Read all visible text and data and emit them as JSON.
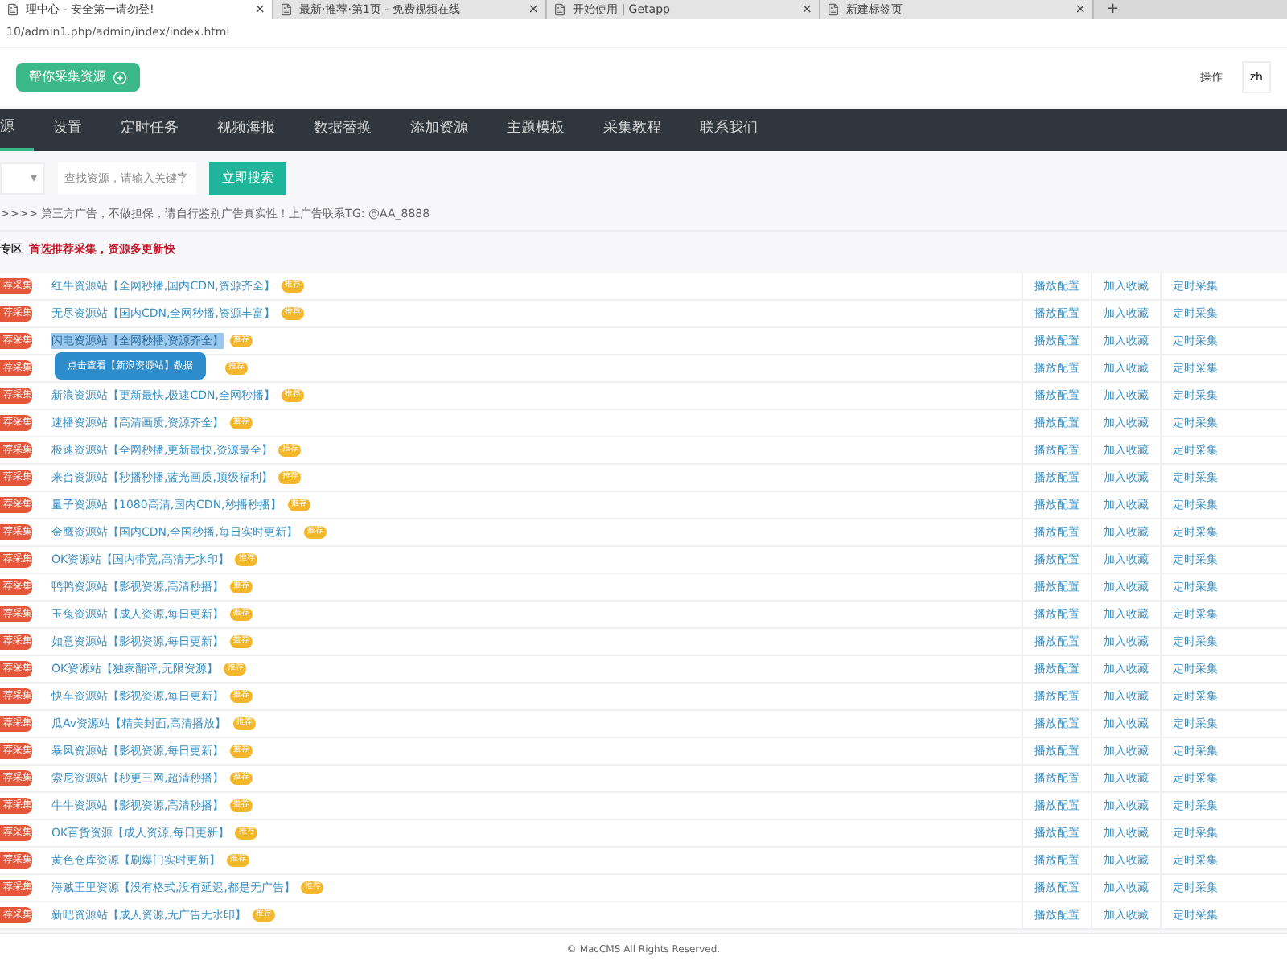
{
  "browser": {
    "tabs": [
      {
        "title": "理中心 - 安全第一请勿登!",
        "selected": true
      },
      {
        "title": "最新·推荐·第1页 - 免费视频在线",
        "selected": false
      },
      {
        "title": "开始使用 | Getapp",
        "selected": false
      },
      {
        "title": "新建标签页",
        "selected": false
      }
    ],
    "close": "×",
    "new_tab": "+",
    "url": "10/admin1.php/admin/index/index.html"
  },
  "header": {
    "button": "帮你采集资源",
    "action_label": "操作",
    "language": "zh"
  },
  "nav": [
    {
      "label": "源",
      "selected": true
    },
    {
      "label": "设置",
      "selected": false
    },
    {
      "label": "定时任务",
      "selected": false
    },
    {
      "label": "视频海报",
      "selected": false
    },
    {
      "label": "数据替换",
      "selected": false
    },
    {
      "label": "添加资源",
      "selected": false
    },
    {
      "label": "主题模板",
      "selected": false
    },
    {
      "label": "采集教程",
      "selected": false
    },
    {
      "label": "联系我们",
      "selected": false
    }
  ],
  "search": {
    "select_caret": "▾",
    "placeholder": "查找资源，请输入关键字",
    "button": "立即搜索"
  },
  "notice": ">>>> 第三方广告，不做担保，请自行鉴别广告真实性！上广告联系TG: @AA_8888",
  "section": {
    "title": "专区",
    "subtitle": "首选推荐采集，资源多更新快"
  },
  "tooltip": {
    "text": "点击查看【新浪资源站】数据"
  },
  "rows": [
    {
      "badge": "荐采集",
      "name": "红牛资源站【全网秒播,国内CDN,资源齐全】",
      "tag": "推荐",
      "selected": false,
      "actions": [
        "播放配置",
        "加入收藏",
        "定时采集"
      ]
    },
    {
      "badge": "荐采集",
      "name": "无尽资源站【国内CDN,全网秒播,资源丰富】",
      "tag": "推荐",
      "selected": false,
      "actions": [
        "播放配置",
        "加入收藏",
        "定时采集"
      ]
    },
    {
      "badge": "荐采集",
      "name": "闪电资源站【全网秒播,资源齐全】",
      "tag": "推荐",
      "selected": true,
      "actions": [
        "播放配置",
        "加入收藏",
        "定时采集"
      ]
    },
    {
      "badge": "荐采集",
      "tag": "推荐",
      "selected": false,
      "actions": [
        "播放配置",
        "加入收藏",
        "定时采集"
      ]
    },
    {
      "badge": "荐采集",
      "name": "新浪资源站【更新最快,极速CDN,全网秒播】",
      "tag": "推荐",
      "selected": false,
      "actions": [
        "播放配置",
        "加入收藏",
        "定时采集"
      ]
    },
    {
      "badge": "荐采集",
      "name": "速播资源站【高清画质,资源齐全】",
      "tag": "推荐",
      "selected": false,
      "actions": [
        "播放配置",
        "加入收藏",
        "定时采集"
      ]
    },
    {
      "badge": "荐采集",
      "name": "极速资源站【全网秒播,更新最快,资源最全】",
      "tag": "推荐",
      "selected": false,
      "actions": [
        "播放配置",
        "加入收藏",
        "定时采集"
      ]
    },
    {
      "badge": "荐采集",
      "name": "来台资源站【秒播秒播,蓝光画质,顶级福利】",
      "tag": "推荐",
      "selected": false,
      "actions": [
        "播放配置",
        "加入收藏",
        "定时采集"
      ]
    },
    {
      "badge": "荐采集",
      "name": "量子资源站【1080高清,国内CDN,秒播秒播】",
      "tag": "推荐",
      "selected": false,
      "actions": [
        "播放配置",
        "加入收藏",
        "定时采集"
      ]
    },
    {
      "badge": "荐采集",
      "name": "金鹰资源站【国内CDN,全国秒播,每日实时更新】",
      "tag": "推荐",
      "selected": false,
      "actions": [
        "播放配置",
        "加入收藏",
        "定时采集"
      ]
    },
    {
      "badge": "荐采集",
      "name": "OK资源站【国内带宽,高清无水印】",
      "tag": "推荐",
      "selected": false,
      "actions": [
        "播放配置",
        "加入收藏",
        "定时采集"
      ]
    },
    {
      "badge": "荐采集",
      "name": "鸭鸭资源站【影视资源,高清秒播】",
      "tag": "推荐",
      "selected": false,
      "actions": [
        "播放配置",
        "加入收藏",
        "定时采集"
      ]
    },
    {
      "badge": "荐采集",
      "name": "玉兔资源站【成人资源,每日更新】",
      "tag": "推荐",
      "selected": false,
      "actions": [
        "播放配置",
        "加入收藏",
        "定时采集"
      ]
    },
    {
      "badge": "荐采集",
      "name": "如意资源站【影视资源,每日更新】",
      "tag": "推荐",
      "selected": false,
      "actions": [
        "播放配置",
        "加入收藏",
        "定时采集"
      ]
    },
    {
      "badge": "荐采集",
      "name": "OK资源站【独家翻译,无限资源】",
      "tag": "推荐",
      "selected": false,
      "actions": [
        "播放配置",
        "加入收藏",
        "定时采集"
      ]
    },
    {
      "badge": "荐采集",
      "name": "快车资源站【影视资源,每日更新】",
      "tag": "推荐",
      "selected": false,
      "actions": [
        "播放配置",
        "加入收藏",
        "定时采集"
      ]
    },
    {
      "badge": "荐采集",
      "name": "瓜Av资源站【精美封面,高清播放】",
      "tag": "推荐",
      "selected": false,
      "actions": [
        "播放配置",
        "加入收藏",
        "定时采集"
      ]
    },
    {
      "badge": "荐采集",
      "name": "暴风资源站【影视资源,每日更新】",
      "tag": "推荐",
      "selected": false,
      "actions": [
        "播放配置",
        "加入收藏",
        "定时采集"
      ]
    },
    {
      "badge": "荐采集",
      "name": "索尼资源站【秒更三网,超清秒播】",
      "tag": "推荐",
      "selected": false,
      "actions": [
        "播放配置",
        "加入收藏",
        "定时采集"
      ]
    },
    {
      "badge": "荐采集",
      "name": "牛牛资源站【影视资源,高清秒播】",
      "tag": "推荐",
      "selected": false,
      "actions": [
        "播放配置",
        "加入收藏",
        "定时采集"
      ]
    },
    {
      "badge": "荐采集",
      "name": "OK百货资源【成人资源,每日更新】",
      "tag": "推荐",
      "selected": false,
      "actions": [
        "播放配置",
        "加入收藏",
        "定时采集"
      ]
    },
    {
      "badge": "荐采集",
      "name": "黄色仓库资源【刷爆门实时更新】",
      "tag": "推荐",
      "selected": false,
      "actions": [
        "播放配置",
        "加入收藏",
        "定时采集"
      ]
    },
    {
      "badge": "荐采集",
      "name": "海贼王里资源【没有格式,没有延迟,都是无广告】",
      "tag": "推荐",
      "selected": false,
      "actions": [
        "播放配置",
        "加入收藏",
        "定时采集"
      ]
    },
    {
      "badge": "荐采集",
      "name": "新吧资源站【成人资源,无广告无水印】",
      "tag": "推荐",
      "selected": false,
      "actions": [
        "播放配置",
        "加入收藏",
        "定时采集"
      ]
    }
  ],
  "footer": "© MacCMS All Rights Reserved."
}
